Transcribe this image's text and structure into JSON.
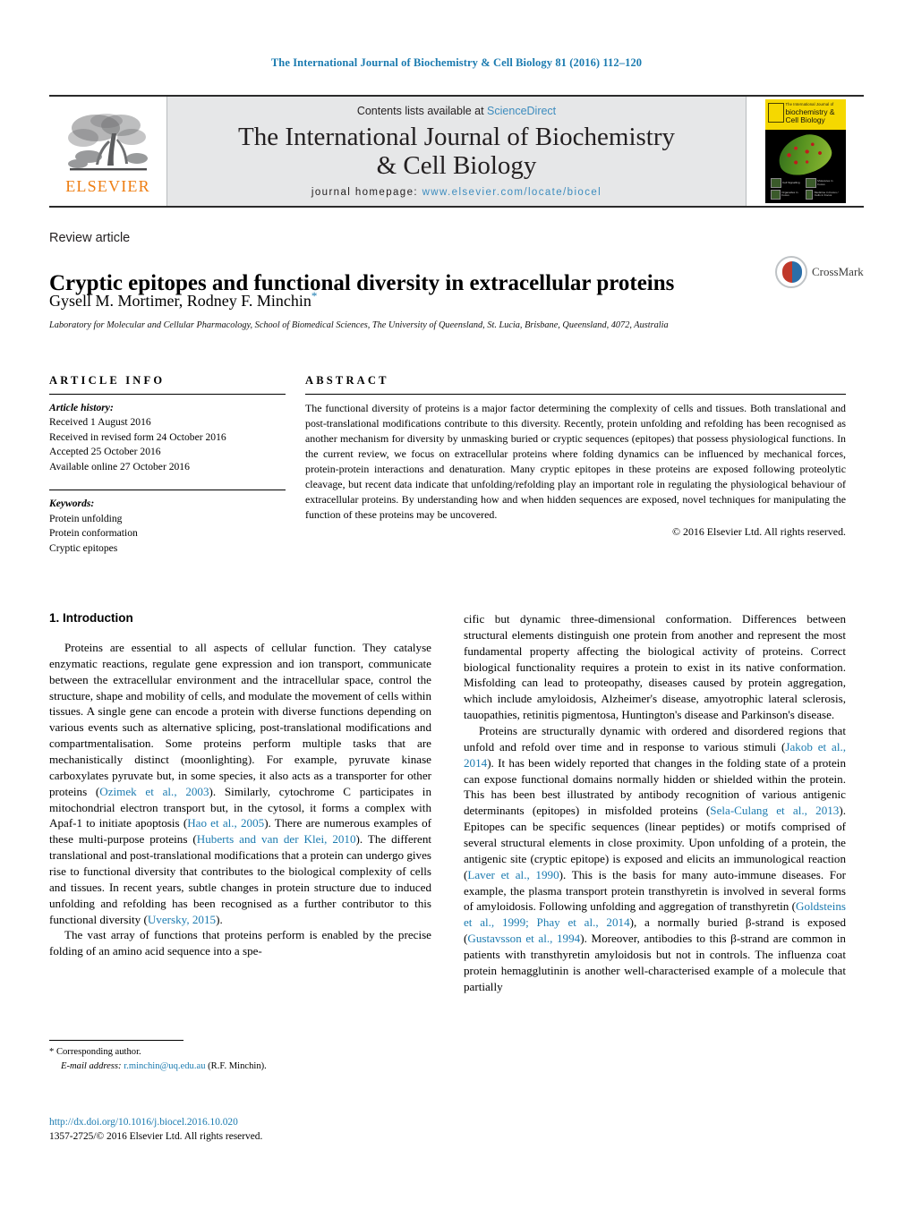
{
  "running_head": "The International Journal of Biochemistry & Cell Biology 81 (2016) 112–120",
  "masthead": {
    "publisher_name": "ELSEVIER",
    "contents_prefix": "Contents lists available at ",
    "contents_link": "ScienceDirect",
    "journal_title_line1": "The International Journal of Biochemistry",
    "journal_title_line2": "& Cell Biology",
    "homepage_prefix": "journal homepage: ",
    "homepage_url": "www.elsevier.com/locate/biocel",
    "cover": {
      "supertitle": "The International Journal of",
      "title_line1": "biochemistry &",
      "title_line2": "Cell Biology",
      "panel_labels": [
        "Cell Signalling",
        "Molecules in Focus",
        "Organelles in Focus",
        "Medicine in Focus / Cells in Focus"
      ]
    }
  },
  "article": {
    "type": "Review article",
    "title": "Cryptic epitopes and functional diversity in extracellular proteins",
    "authors": "Gysell M. Mortimer, Rodney F. Minchin",
    "corresponding_marker": "*",
    "affiliation": "Laboratory for Molecular and Cellular Pharmacology, School of Biomedical Sciences, The University of Queensland, St. Lucia, Brisbane, Queensland, 4072, Australia",
    "crossmark_label": "CrossMark"
  },
  "article_info": {
    "heading": "ARTICLE INFO",
    "history_label": "Article history:",
    "history": [
      "Received 1 August 2016",
      "Received in revised form 24 October 2016",
      "Accepted 25 October 2016",
      "Available online 27 October 2016"
    ],
    "keywords_label": "Keywords:",
    "keywords": [
      "Protein unfolding",
      "Protein conformation",
      "Cryptic epitopes"
    ]
  },
  "abstract": {
    "heading": "ABSTRACT",
    "text": "The functional diversity of proteins is a major factor determining the complexity of cells and tissues. Both translational and post-translational modifications contribute to this diversity. Recently, protein unfolding and refolding has been recognised as another mechanism for diversity by unmasking buried or cryptic sequences (epitopes) that possess physiological functions. In the current review, we focus on extracellular proteins where folding dynamics can be influenced by mechanical forces, protein-protein interactions and denaturation. Many cryptic epitopes in these proteins are exposed following proteolytic cleavage, but recent data indicate that unfolding/refolding play an important role in regulating the physiological behaviour of extracellular proteins. By understanding how and when hidden sequences are exposed, novel techniques for manipulating the function of these proteins may be uncovered.",
    "copyright": "© 2016 Elsevier Ltd. All rights reserved."
  },
  "body": {
    "section_number_title": "1.  Introduction",
    "left_paragraphs": [
      {
        "parts": [
          {
            "t": "Proteins are essential to all aspects of cellular function. They catalyse enzymatic reactions, regulate gene expression and ion transport, communicate between the extracellular environment and the intracellular space, control the structure, shape and mobility of cells, and modulate the movement of cells within tissues. A single gene can encode a protein with diverse functions depending on various events such as alternative splicing, post-translational modifications and compartmentalisation. Some proteins perform multiple tasks that are mechanistically distinct (moonlighting). For example, pyruvate kinase carboxylates pyruvate but, in some species, it also acts as a transporter for other proteins ("
          },
          {
            "t": "Ozimek et al., 2003",
            "ref": true
          },
          {
            "t": "). Similarly, cytochrome C participates in mitochondrial electron transport but, in the cytosol, it forms a complex with Apaf-1 to initiate apoptosis ("
          },
          {
            "t": "Hao et al., 2005",
            "ref": true
          },
          {
            "t": "). There are numerous examples of these multi-purpose proteins ("
          },
          {
            "t": "Huberts and van der Klei, 2010",
            "ref": true
          },
          {
            "t": "). The different translational and post-translational modifications that a protein can undergo gives rise to functional diversity that contributes to the biological complexity of cells and tissues. In recent years, subtle changes in protein structure due to induced unfolding and refolding has been recognised as a further contributor to this functional diversity ("
          },
          {
            "t": "Uversky, 2015",
            "ref": true
          },
          {
            "t": ")."
          }
        ]
      },
      {
        "parts": [
          {
            "t": "The vast array of functions that proteins perform is enabled by the precise folding of an amino acid sequence into a spe-"
          }
        ]
      }
    ],
    "right_paragraphs": [
      {
        "continued": true,
        "parts": [
          {
            "t": "cific but dynamic three-dimensional conformation. Differences between structural elements distinguish one protein from another and represent the most fundamental property affecting the biological activity of proteins. Correct biological functionality requires a protein to exist in its native conformation. Misfolding can lead to proteopathy, diseases caused by protein aggregation, which include amyloidosis, Alzheimer's disease, amyotrophic lateral sclerosis, tauopathies, retinitis pigmentosa, Huntington's disease and Parkinson's disease."
          }
        ]
      },
      {
        "parts": [
          {
            "t": "Proteins are structurally dynamic with ordered and disordered regions that unfold and refold over time and in response to various stimuli ("
          },
          {
            "t": "Jakob et al., 2014",
            "ref": true
          },
          {
            "t": "). It has been widely reported that changes in the folding state of a protein can expose functional domains normally hidden or shielded within the protein. This has been best illustrated by antibody recognition of various antigenic determinants (epitopes) in misfolded proteins ("
          },
          {
            "t": "Sela-Culang et al., 2013",
            "ref": true
          },
          {
            "t": "). Epitopes can be specific sequences (linear peptides) or motifs comprised of several structural elements in close proximity. Upon unfolding of a protein, the antigenic site (cryptic epitope) is exposed and elicits an immunological reaction ("
          },
          {
            "t": "Laver et al., 1990",
            "ref": true
          },
          {
            "t": "). This is the basis for many auto-immune diseases. For example, the plasma transport protein transthyretin is involved in several forms of amyloidosis. Following unfolding and aggregation of transthyretin ("
          },
          {
            "t": "Goldsteins et al., 1999; Phay et al., 2014",
            "ref": true
          },
          {
            "t": "), a normally buried β-strand is exposed ("
          },
          {
            "t": "Gustavsson et al., 1994",
            "ref": true
          },
          {
            "t": "). Moreover, antibodies to this β-strand are common in patients with transthyretin amyloidosis but not in controls. The influenza coat protein hemagglutinin is another well-characterised example of a molecule that partially"
          }
        ]
      }
    ]
  },
  "footnote": {
    "corresponding": "*  Corresponding author.",
    "email_label": "E-mail address:",
    "email": "r.minchin@uq.edu.au",
    "email_suffix": "(R.F. Minchin)."
  },
  "doi": {
    "link": "http://dx.doi.org/10.1016/j.biocel.2016.10.020",
    "issn_line": "1357-2725/© 2016 Elsevier Ltd. All rights reserved."
  },
  "colors": {
    "link": "#1b7bb0",
    "elsevier_orange": "#ee7d11",
    "masthead_grey": "#e6e7e8",
    "cover_yellow": "#f5d800"
  }
}
